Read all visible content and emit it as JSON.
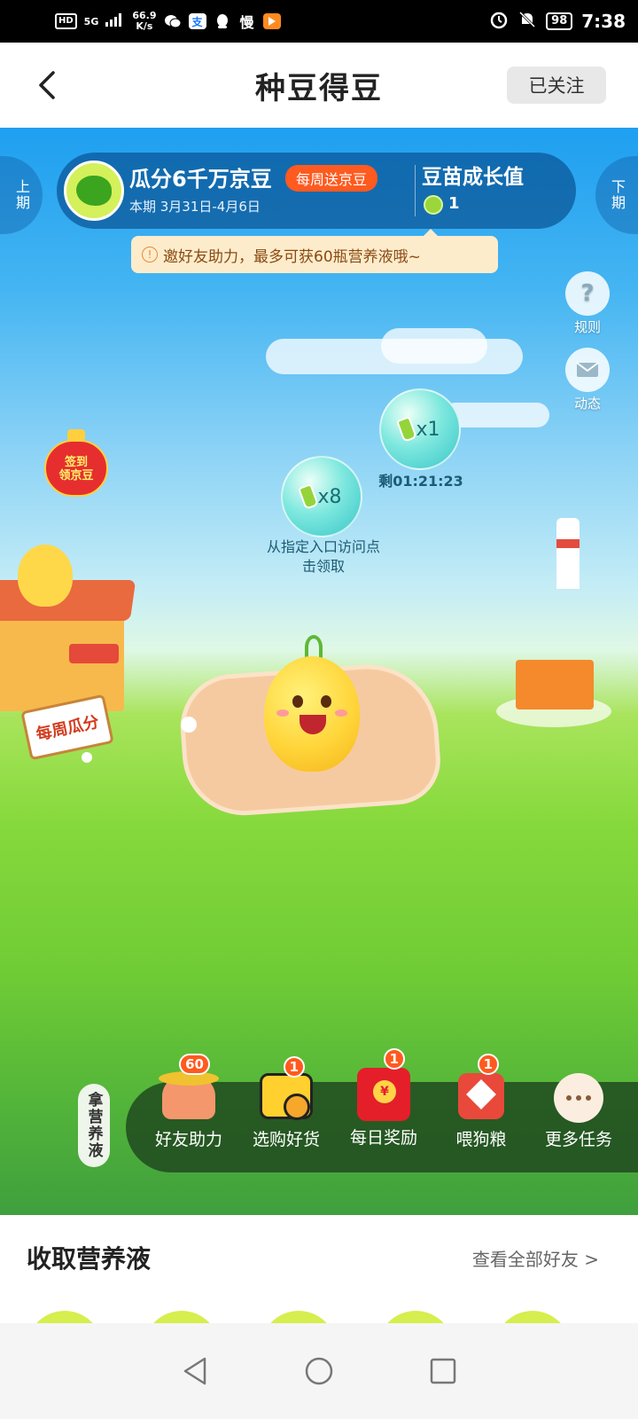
{
  "status_bar": {
    "hd": "HD",
    "signal": "5G",
    "speed_value": "66.9",
    "speed_unit": "K/s",
    "battery": "98",
    "time": "7:38",
    "app_icons": [
      "wechat-icon",
      "alipay-icon",
      "qq-icon",
      "man-icon",
      "video-icon"
    ]
  },
  "header": {
    "title": "种豆得豆",
    "follow_label": "已关注"
  },
  "nav": {
    "prev_period": "上期",
    "next_period": "下期"
  },
  "banner": {
    "title": "瓜分6千万京豆",
    "tag": "每周送京豆",
    "period": "本期 3月31日-4月6日",
    "growth_label": "豆苗成长值",
    "growth_value": "1"
  },
  "tip": {
    "text": "邀好友助力，最多可获60瓶营养液哦~"
  },
  "side_buttons": {
    "rules_label": "规则",
    "news_label": "动态"
  },
  "signin": {
    "line1": "签到",
    "line2": "领京豆"
  },
  "bubbles": [
    {
      "count": "x1",
      "caption": "剩01:21:23"
    },
    {
      "count": "x8",
      "caption_line1": "从指定入口访问点",
      "caption_line2": "击领取"
    }
  ],
  "weekly_sign": "每周瓜分",
  "nutrient_tag": "拿营养液",
  "tasks": [
    {
      "label": "好友助力",
      "badge": "60",
      "icon": "farmer-icon"
    },
    {
      "label": "选购好货",
      "badge": "1",
      "icon": "shopping-cup-icon"
    },
    {
      "label": "每日奖励",
      "badge": "1",
      "icon": "red-envelope-icon"
    },
    {
      "label": "喂狗粮",
      "badge": "1",
      "icon": "fortune-bag-icon"
    },
    {
      "label": "更多任务",
      "badge": "",
      "icon": "more-dots-icon"
    }
  ],
  "card": {
    "title": "收取营养液",
    "view_all": "查看全部好友 >"
  },
  "colors": {
    "accent_orange": "#ff5a1f",
    "banner_blue": "#0a5596",
    "tip_bg": "#fdeccb",
    "grass_green": "#6fcb35"
  }
}
